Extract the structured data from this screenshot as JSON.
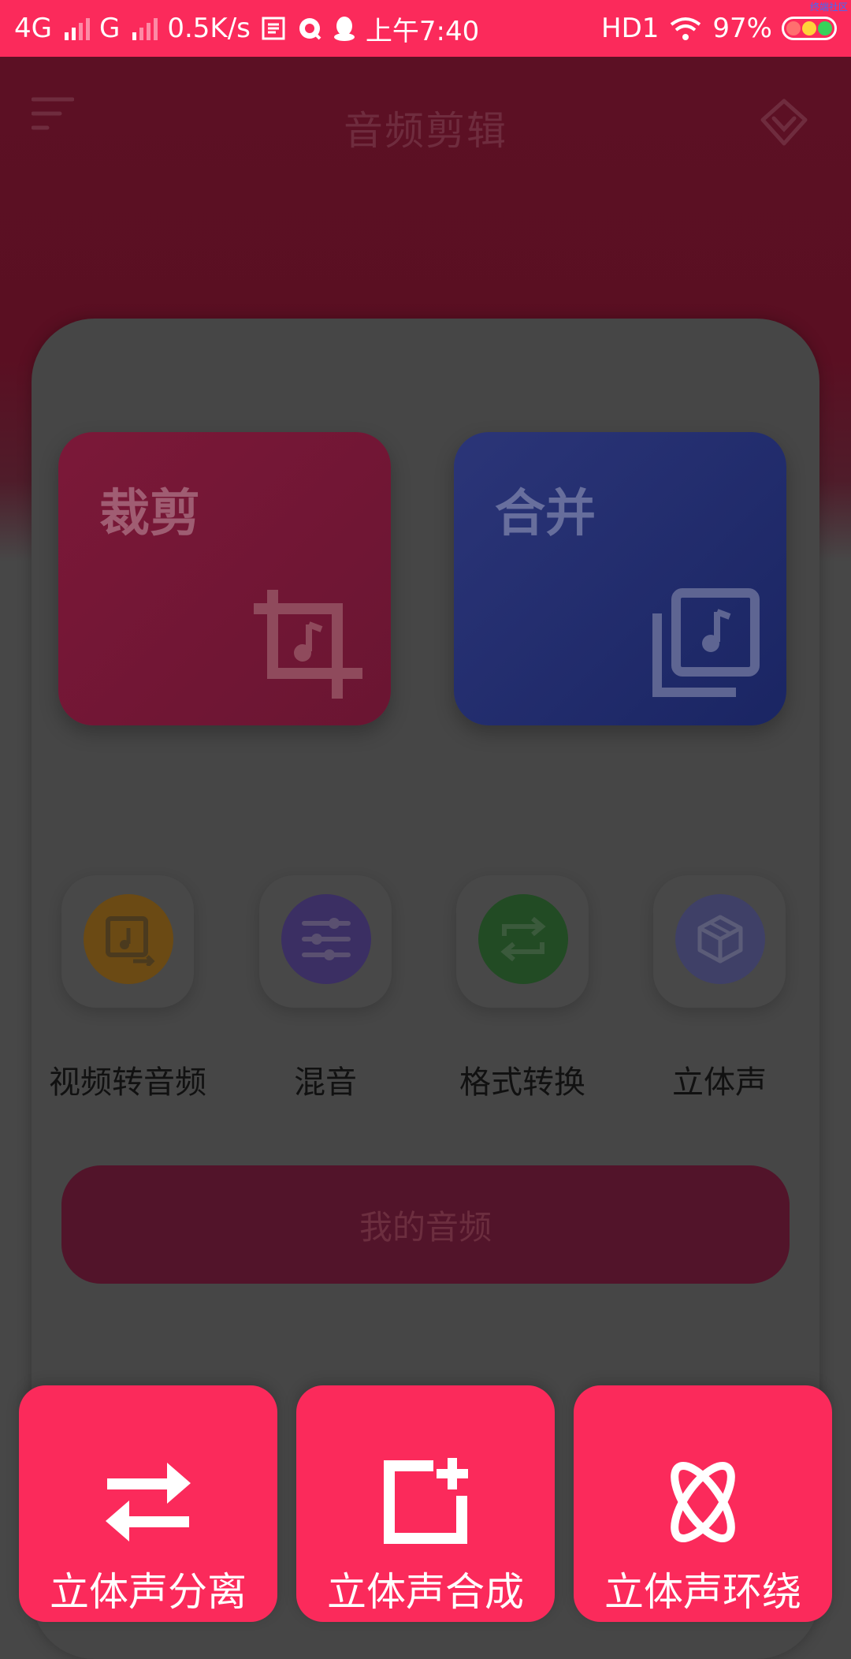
{
  "status_bar": {
    "network_1": "4G",
    "network_2": "G",
    "speed": "0.5K/s",
    "time": "上午7:40",
    "hd_label": "HD1",
    "battery": "97%",
    "corner_tag": "终端社区"
  },
  "header": {
    "title": "音频剪辑"
  },
  "tiles": [
    {
      "label": "裁剪",
      "icon": "crop-music-icon"
    },
    {
      "label": "合并",
      "icon": "library-music-icon"
    }
  ],
  "features": [
    {
      "label": "视频转音频",
      "icon": "video-to-audio-icon",
      "color": "#6b4a14"
    },
    {
      "label": "混音",
      "icon": "equalizer-icon",
      "color": "#3b2f63"
    },
    {
      "label": "格式转换",
      "icon": "repeat-icon",
      "color": "#224b24"
    },
    {
      "label": "立体声",
      "icon": "cube-icon",
      "color": "#3f4067"
    }
  ],
  "my_audio_button": "我的音频",
  "sheet": [
    {
      "label": "立体声分离",
      "icon": "swap-arrows-icon"
    },
    {
      "label": "立体声合成",
      "icon": "add-frame-icon"
    },
    {
      "label": "立体声环绕",
      "icon": "orbit-icon"
    }
  ],
  "colors": {
    "accent": "#fb2a5b",
    "overlay_dim": "#474747",
    "merge_tile": "#1a2563"
  }
}
